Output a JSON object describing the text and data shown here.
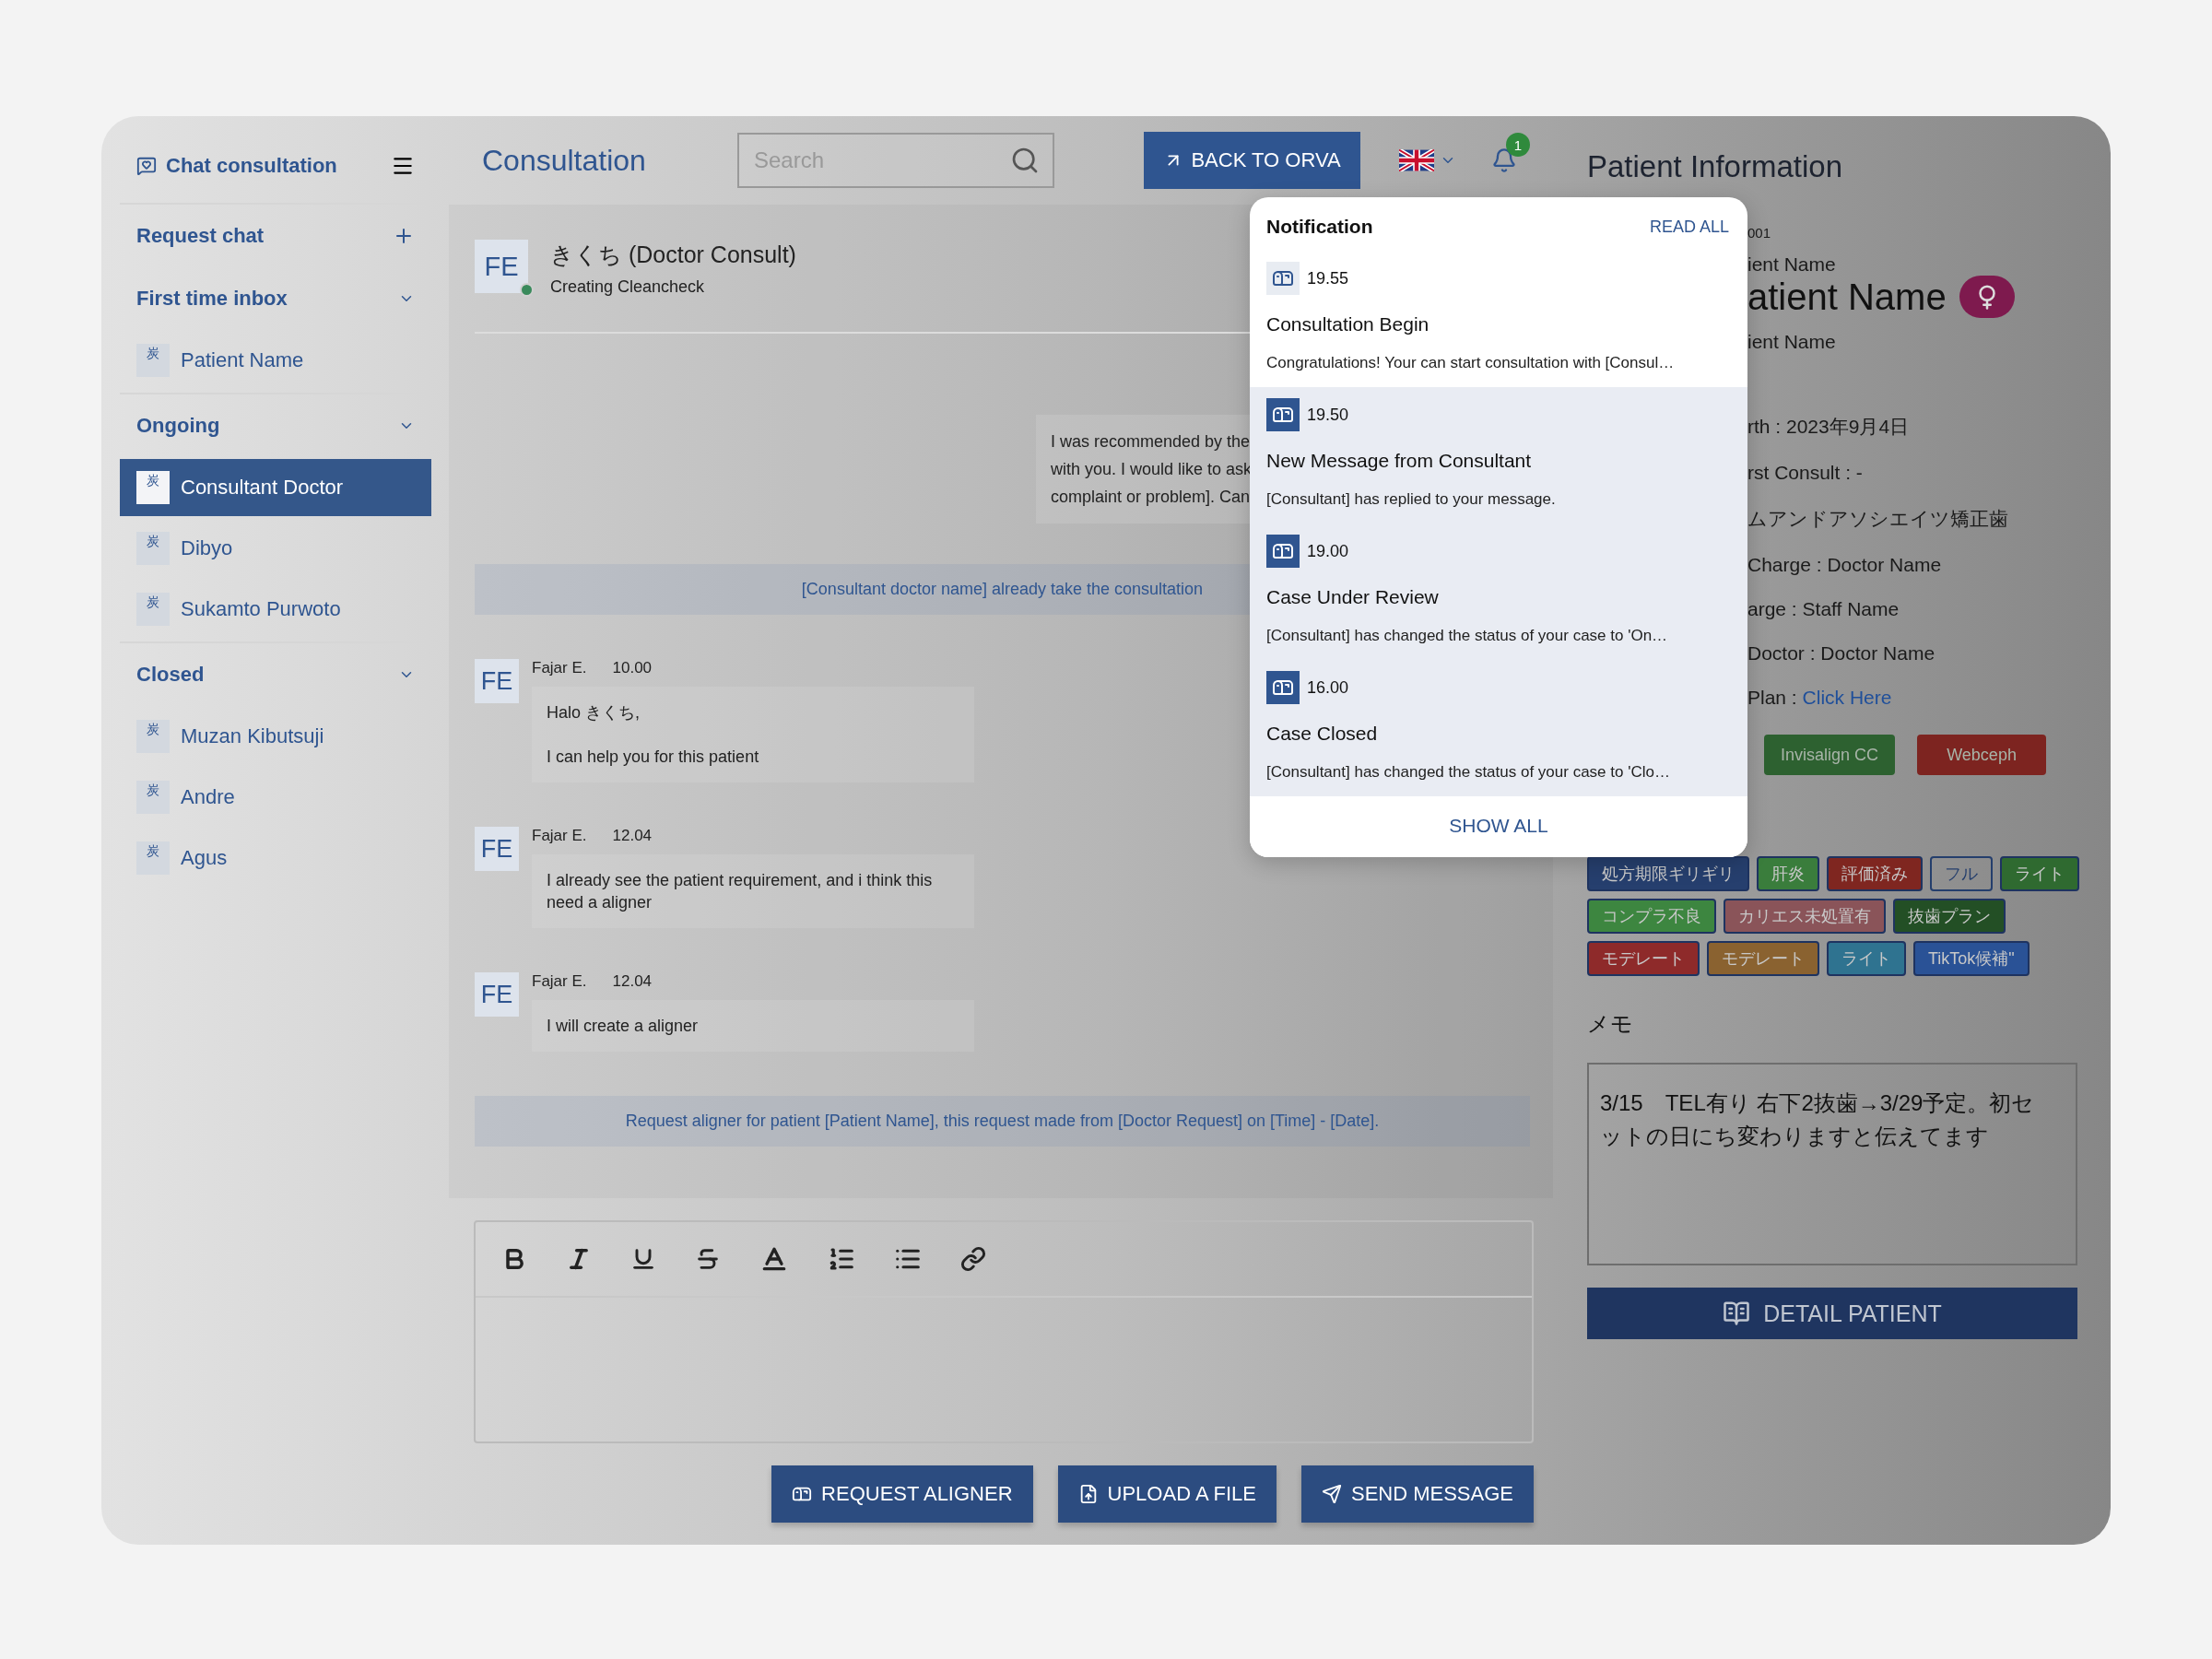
{
  "sidebar": {
    "title": "Chat consultation",
    "sections": [
      {
        "label": "Request chat",
        "kind": "action"
      },
      {
        "label": "First time inbox",
        "kind": "group",
        "expanded": true,
        "items": [
          {
            "avatar": "炭",
            "name": "Patient Name",
            "selected": false
          }
        ]
      },
      {
        "label": "Ongoing",
        "kind": "group",
        "expanded": true,
        "items": [
          {
            "avatar": "炭",
            "name": "Consultant Doctor",
            "selected": true
          },
          {
            "avatar": "炭",
            "name": "Dibyo",
            "selected": false
          },
          {
            "avatar": "炭",
            "name": "Sukamto Purwoto",
            "selected": false
          }
        ]
      },
      {
        "label": "Closed",
        "kind": "group",
        "expanded": true,
        "items": [
          {
            "avatar": "炭",
            "name": "Muzan Kibutsuji",
            "selected": false
          },
          {
            "avatar": "炭",
            "name": "Andre",
            "selected": false
          },
          {
            "avatar": "炭",
            "name": "Agus",
            "selected": false
          }
        ]
      }
    ]
  },
  "header": {
    "title": "Consultation",
    "search": {
      "placeholder": "Search"
    },
    "back_button": "BACK TO ORVA",
    "notification_count": "1"
  },
  "chat": {
    "contact": {
      "initials": "FE",
      "online": true,
      "name": "きくち (Doctor Consult)",
      "subtitle": "Creating Cleancheck"
    },
    "messages": [
      {
        "kind": "outgoing",
        "text": "I was recommended by the\nwith you. I would like to ask\ncomplaint or problem]. Can"
      },
      {
        "kind": "system",
        "text": "[Consultant doctor name] already take the consultation"
      },
      {
        "kind": "incoming",
        "initials": "FE",
        "sender": "Fajar E.",
        "time": "10.00",
        "text": "Halo きくち,\n\nI can help you for this patient"
      },
      {
        "kind": "incoming",
        "initials": "FE",
        "sender": "Fajar E.",
        "time": "12.04",
        "text": "I already see the patient requirement, and i think this need a aligner"
      },
      {
        "kind": "incoming",
        "initials": "FE",
        "sender": "Fajar E.",
        "time": "12.04",
        "text": "I will create a aligner"
      },
      {
        "kind": "system",
        "text": "Request aligner for patient [Patient Name], this request made from [Doctor Request] on [Time] - [Date]."
      }
    ]
  },
  "actions": [
    {
      "kind": "aligner",
      "label": "REQUEST ALIGNER"
    },
    {
      "kind": "upload",
      "label": "UPLOAD A FILE"
    },
    {
      "kind": "send",
      "label": "SEND MESSAGE"
    }
  ],
  "patient": {
    "title": "Patient Information",
    "id": "001",
    "name_top": "ient Name",
    "name": "atient Name",
    "female": true,
    "name_bottom": "ient Name",
    "details": [
      {
        "text": "rth : 2023年9月4日"
      },
      {
        "text": "rst Consult : -"
      },
      {
        "text": "ムアンドアソシエイツ矯正歯"
      },
      {
        "text": "Charge : Doctor Name"
      },
      {
        "text": "arge : Staff Name"
      },
      {
        "text": "Doctor : Doctor Name"
      },
      {
        "text": "Plan : ",
        "link": "Click Here"
      }
    ],
    "buttons": [
      {
        "label": "Invisalign CC",
        "color": "#2d6130"
      },
      {
        "label": "Webceph",
        "color": "#7d2420"
      }
    ],
    "tags": [
      {
        "label": "処方期限ギリギリ",
        "kind": "filled",
        "color": "#263f6e"
      },
      {
        "label": "肝炎",
        "kind": "filled",
        "color": "#3a7d3c"
      },
      {
        "label": "評価済み",
        "kind": "filled",
        "color": "#7f2620"
      },
      {
        "label": "フル",
        "kind": "outlined"
      },
      {
        "label": "ライト",
        "kind": "filled",
        "color": "#2f6a30"
      },
      {
        "label": "コンプラ不良",
        "kind": "filled",
        "color": "#3d8640"
      },
      {
        "label": "カリエス未処置有",
        "kind": "filled",
        "color": "#8a5459"
      },
      {
        "label": "抜歯プラン",
        "kind": "filled",
        "color": "#234f25"
      },
      {
        "label": "モデレート",
        "kind": "filled",
        "color": "#8e2a2a"
      },
      {
        "label": "モデレート",
        "kind": "filled",
        "color": "#8a6230"
      },
      {
        "label": "ライト",
        "kind": "filled",
        "color": "#2f7390"
      },
      {
        "label": "TikTok候補\"",
        "kind": "filled",
        "color": "#2a5296"
      }
    ],
    "memo": {
      "label": "メモ",
      "value": "3/15　TEL有り 右下2抜歯→3/29予定。初セットの日にち変わりますと伝えてます"
    },
    "detail_button": "DETAIL PATIENT"
  },
  "notifications": {
    "title": "Notification",
    "read_all": "READ ALL",
    "items": [
      {
        "unread": false,
        "time": "19.55",
        "title": "Consultation Begin",
        "body": "Congratulations! Your can start consultation with [Consul…"
      },
      {
        "unread": true,
        "time": "19.50",
        "title": "New Message from Consultant",
        "body": "[Consultant] has replied to your message."
      },
      {
        "unread": true,
        "time": "19.00",
        "title": "Case Under Review",
        "body": "[Consultant] has changed the status of your case to 'On…"
      },
      {
        "unread": true,
        "time": "16.00",
        "title": "Case Closed",
        "body": "[Consultant] has changed the status of your case to 'Clo…"
      }
    ],
    "show_all": "SHOW ALL"
  }
}
